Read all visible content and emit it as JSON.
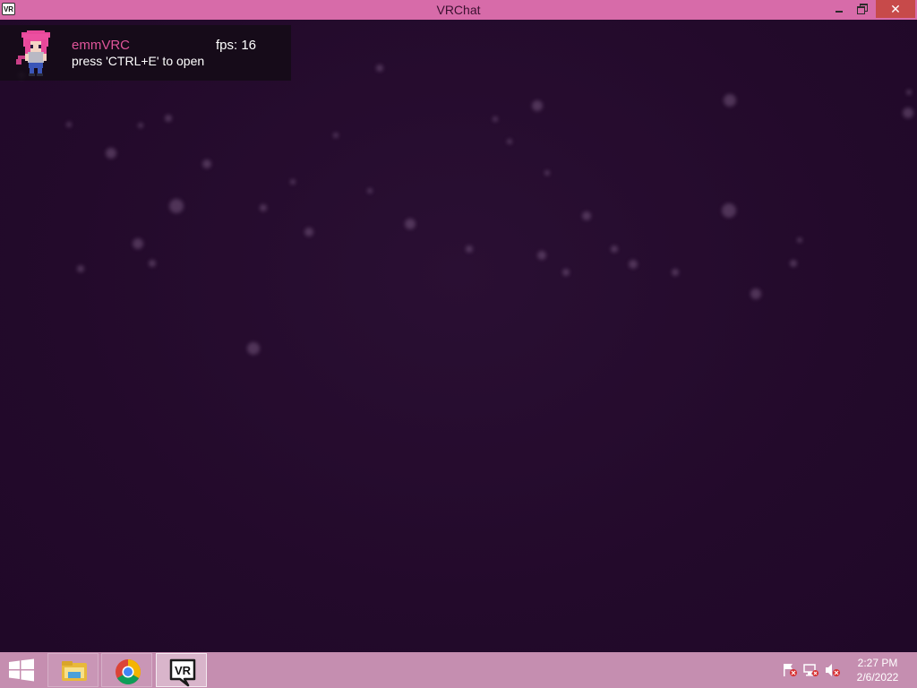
{
  "window": {
    "title": "VRChat",
    "app_icon_label": "VR",
    "close_label": "✕",
    "accent": "#d76ba9"
  },
  "overlay": {
    "username": "emmVRC",
    "fps_text": "fps: 16",
    "hint": "press 'CTRL+E' to open",
    "name_color": "#e0559a"
  },
  "taskbar": {
    "apps": [
      {
        "name": "file-explorer",
        "icon": "folder-icon",
        "active": false
      },
      {
        "name": "google-chrome",
        "icon": "chrome-icon",
        "active": false
      },
      {
        "name": "vrchat",
        "icon": "vrchat-icon",
        "active": true,
        "label": "VR"
      }
    ],
    "tray": {
      "icons": [
        "action-center-flag-icon",
        "network-icon",
        "volume-muted-icon"
      ]
    },
    "clock": {
      "time": "2:27 PM",
      "date": "2/6/2022"
    }
  }
}
